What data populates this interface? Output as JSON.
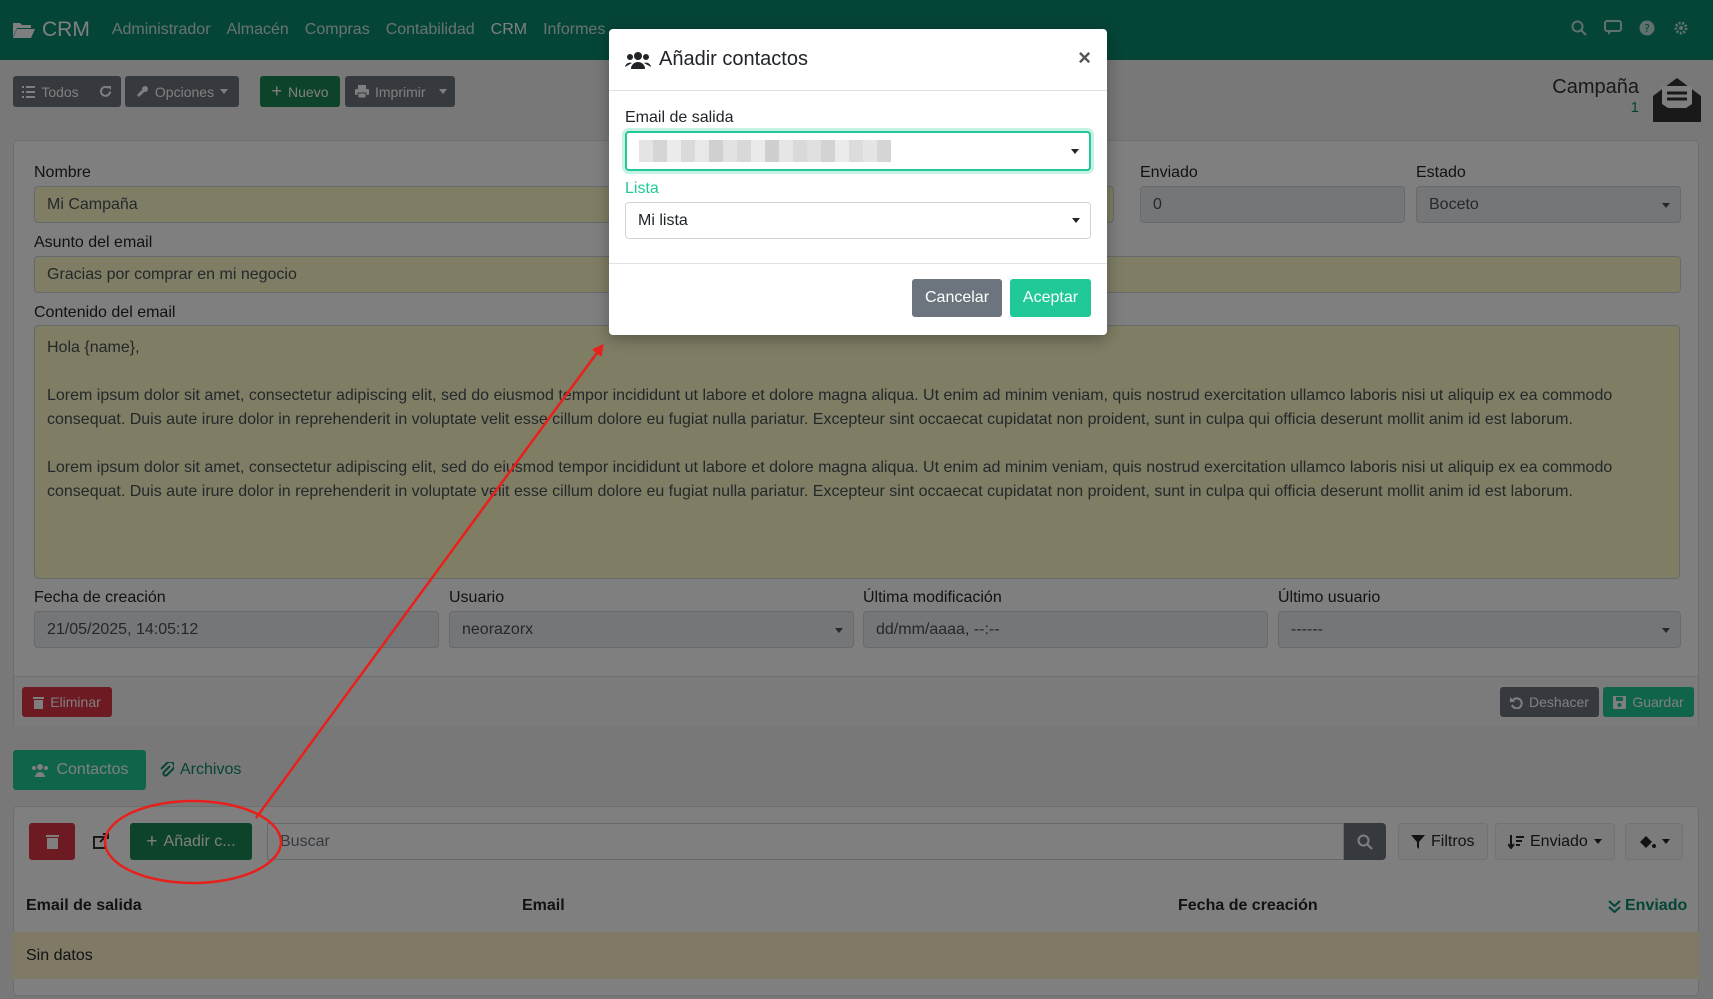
{
  "navbar": {
    "brand": "CRM",
    "menu": [
      "Administrador",
      "Almacén",
      "Compras",
      "Contabilidad",
      "CRM",
      "Informes"
    ],
    "active": "CRM"
  },
  "toolbar": {
    "all_label": "Todos",
    "options_label": "Opciones",
    "new_label": "Nuevo",
    "print_label": "Imprimir"
  },
  "record": {
    "model": "Campaña",
    "id": "1"
  },
  "form": {
    "name_label": "Nombre",
    "name_value": "Mi Campaña",
    "sent_label": "Enviado",
    "sent_value": "0",
    "status_label": "Estado",
    "status_value": "Boceto",
    "subject_label": "Asunto del email",
    "subject_value": "Gracias por comprar en mi negocio",
    "content_label": "Contenido del email",
    "content_lines": [
      "Hola {name},",
      "Lorem ipsum dolor sit amet, consectetur adipiscing elit, sed do eiusmod tempor incididunt ut labore et dolore magna aliqua. Ut enim ad minim veniam, quis nostrud exercitation ullamco laboris nisi ut aliquip ex ea commodo consequat. Duis aute irure dolor in reprehenderit in voluptate velit esse cillum dolore eu fugiat nulla pariatur. Excepteur sint occaecat cupidatat non proident, sunt in culpa qui officia deserunt mollit anim id est laborum.",
      "Lorem ipsum dolor sit amet, consectetur adipiscing elit, sed do eiusmod tempor incididunt ut labore et dolore magna aliqua. Ut enim ad minim veniam, quis nostrud exercitation ullamco laboris nisi ut aliquip ex ea commodo consequat. Duis aute irure dolor in reprehenderit in voluptate velit esse cillum dolore eu fugiat nulla pariatur. Excepteur sint occaecat cupidatat non proident, sunt in culpa qui officia deserunt mollit anim id est laborum."
    ],
    "created_label": "Fecha de creación",
    "created_value": "21/05/2025, 14:05:12",
    "user_label": "Usuario",
    "user_value": "neorazorx",
    "modified_label": "Última modificación",
    "modified_value": "dd/mm/aaaa, --:--",
    "last_user_label": "Último usuario",
    "last_user_value": "------",
    "delete_label": "Eliminar",
    "undo_label": "Deshacer",
    "save_label": "Guardar"
  },
  "tabs": {
    "contacts": "Contactos",
    "files": "Archivos"
  },
  "list": {
    "add_label": "Añadir c...",
    "search_placeholder": "Buscar",
    "filters_label": "Filtros",
    "sort_label": "Enviado",
    "columns": [
      "Email de salida",
      "Email",
      "Fecha de creación",
      "Enviado"
    ],
    "empty": "Sin datos"
  },
  "modal": {
    "title": "Añadir contactos",
    "email_label": "Email de salida",
    "list_label": "Lista",
    "list_value": "Mi lista",
    "cancel_label": "Cancelar",
    "accept_label": "Aceptar"
  },
  "colors": {
    "primary": "#0b8a6f",
    "accent": "#20c997",
    "annotation": "#e8201c"
  }
}
